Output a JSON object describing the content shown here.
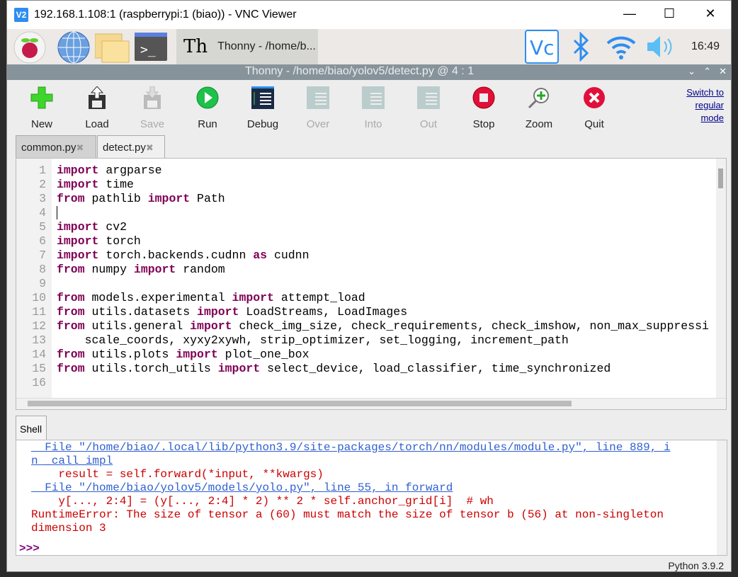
{
  "window": {
    "title": "192.168.1.108:1 (raspberrypi:1 (biao)) - VNC Viewer",
    "logo": "V2"
  },
  "panel": {
    "taskbar_item": "Thonny  -  /home/b...",
    "clock": "16:49",
    "icons": [
      "raspberry-icon",
      "globe-icon",
      "folder-icon",
      "terminal-icon",
      "vnc-icon",
      "bluetooth-icon",
      "wifi-icon",
      "volume-icon"
    ]
  },
  "thonny": {
    "title": "Thonny  -  /home/biao/yolov5/detect.py  @  4 : 1"
  },
  "toolbar": {
    "buttons": [
      {
        "label": "New",
        "enabled": true
      },
      {
        "label": "Load",
        "enabled": true
      },
      {
        "label": "Save",
        "enabled": false
      },
      {
        "label": "Run",
        "enabled": true
      },
      {
        "label": "Debug",
        "enabled": true
      },
      {
        "label": "Over",
        "enabled": false
      },
      {
        "label": "Into",
        "enabled": false
      },
      {
        "label": "Out",
        "enabled": false
      },
      {
        "label": "Stop",
        "enabled": true
      },
      {
        "label": "Zoom",
        "enabled": true
      },
      {
        "label": "Quit",
        "enabled": true
      }
    ],
    "switch_mode": [
      "Switch to",
      "regular",
      "mode"
    ]
  },
  "tabs": [
    {
      "label": "common.py",
      "active": false
    },
    {
      "label": "detect.py",
      "active": true
    }
  ],
  "editor": {
    "lines": [
      [
        {
          "t": "import",
          "k": 1
        },
        {
          "t": " argparse"
        }
      ],
      [
        {
          "t": "import",
          "k": 1
        },
        {
          "t": " time"
        }
      ],
      [
        {
          "t": "from",
          "k": 1
        },
        {
          "t": " pathlib "
        },
        {
          "t": "import",
          "k": 1
        },
        {
          "t": " Path"
        }
      ],
      [
        {
          "t": ""
        }
      ],
      [
        {
          "t": "import",
          "k": 1
        },
        {
          "t": " cv2"
        }
      ],
      [
        {
          "t": "import",
          "k": 1
        },
        {
          "t": " torch"
        }
      ],
      [
        {
          "t": "import",
          "k": 1
        },
        {
          "t": " torch.backends.cudnn "
        },
        {
          "t": "as",
          "k": 1
        },
        {
          "t": " cudnn"
        }
      ],
      [
        {
          "t": "from",
          "k": 1
        },
        {
          "t": " numpy "
        },
        {
          "t": "import",
          "k": 1
        },
        {
          "t": " random"
        }
      ],
      [
        {
          "t": ""
        }
      ],
      [
        {
          "t": "from",
          "k": 1
        },
        {
          "t": " models.experimental "
        },
        {
          "t": "import",
          "k": 1
        },
        {
          "t": " attempt_load"
        }
      ],
      [
        {
          "t": "from",
          "k": 1
        },
        {
          "t": " utils.datasets "
        },
        {
          "t": "import",
          "k": 1
        },
        {
          "t": " LoadStreams, LoadImages"
        }
      ],
      [
        {
          "t": "from",
          "k": 1
        },
        {
          "t": " utils.general "
        },
        {
          "t": "import",
          "k": 1
        },
        {
          "t": " check_img_size, check_requirements, check_imshow, non_max_suppressi"
        }
      ],
      [
        {
          "t": "    scale_coords, xyxy2xywh, strip_optimizer, set_logging, increment_path"
        }
      ],
      [
        {
          "t": "from",
          "k": 1
        },
        {
          "t": " utils.plots "
        },
        {
          "t": "import",
          "k": 1
        },
        {
          "t": " plot_one_box"
        }
      ],
      [
        {
          "t": "from",
          "k": 1
        },
        {
          "t": " utils.torch_utils "
        },
        {
          "t": "import",
          "k": 1
        },
        {
          "t": " select_device, load_classifier, time_synchronized"
        }
      ],
      [
        {
          "t": ""
        }
      ]
    ]
  },
  "shell": {
    "tab": "Shell",
    "lines": [
      {
        "t": "  File \"/home/biao/.local/lib/python3.9/site-packages/torch/nn/modules/module.py\", line 889, i",
        "type": "link"
      },
      {
        "t": "n _call_impl",
        "type": "link"
      },
      {
        "t": "    result = self.forward(*input, **kwargs)",
        "type": "err"
      },
      {
        "t": "  File \"/home/biao/yolov5/models/yolo.py\", line 55, in forward",
        "type": "link"
      },
      {
        "t": "    y[..., 2:4] = (y[..., 2:4] * 2) ** 2 * self.anchor_grid[i]  # wh",
        "type": "err"
      },
      {
        "t": "RuntimeError: The size of tensor a (60) must match the size of tensor b (56) at non-singleton",
        "type": "err"
      },
      {
        "t": "dimension 3",
        "type": "err"
      },
      {
        "t": "",
        "type": "err"
      },
      {
        "t": ">>>",
        "type": "prompt"
      }
    ]
  },
  "status": "Python 3.9.2"
}
